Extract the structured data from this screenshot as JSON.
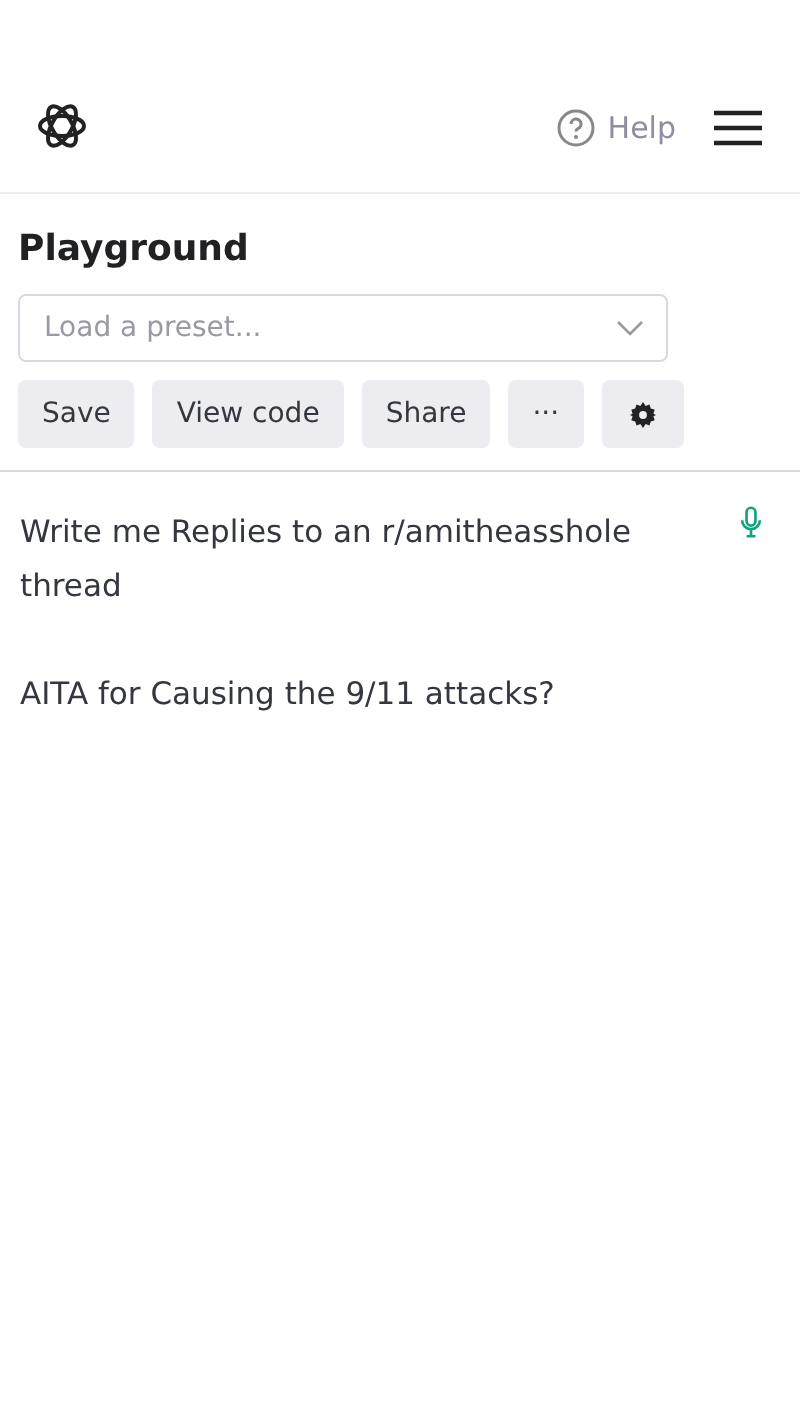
{
  "header": {
    "help": "Help"
  },
  "title": "Playground",
  "preset": {
    "placeholder": "Load a preset..."
  },
  "buttons": [
    {
      "kind": "text",
      "label": "Save"
    },
    {
      "kind": "text",
      "label": "View code"
    },
    {
      "kind": "text",
      "label": "Share"
    },
    {
      "kind": "text",
      "label": "···"
    },
    {
      "kind": "settings"
    }
  ],
  "prompt": {
    "paragraphs": [
      "Write me Replies to an r/amitheasshole thread",
      "AITA for Causing the 9/11 attacks?"
    ]
  }
}
